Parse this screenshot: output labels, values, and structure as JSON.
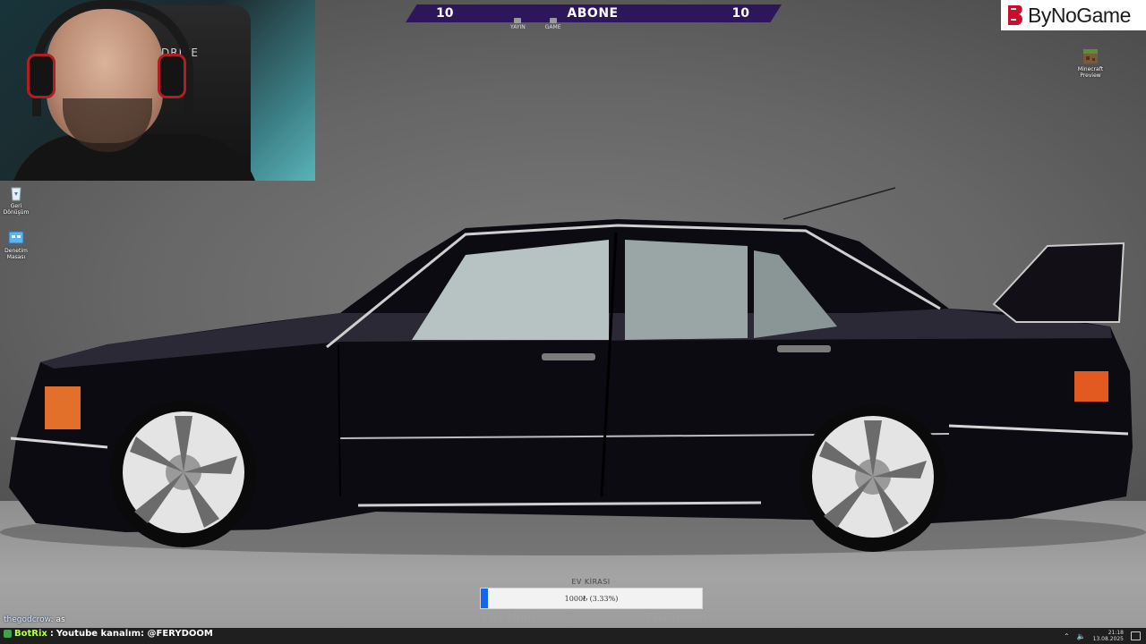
{
  "goal_banner": {
    "left_count": "10",
    "title": "ABONE",
    "right_count": "10",
    "sub_icons": [
      {
        "label": "YAYIN",
        "icon": "stream-icon"
      },
      {
        "label": "GAME",
        "icon": "game-icon"
      }
    ]
  },
  "logo": {
    "text": "ByNoGame",
    "icon": "bynogame-logo-icon"
  },
  "webcam": {
    "chair_brand": "DRIVE"
  },
  "desktop_icons": [
    {
      "label": "Geri Dönüşüm",
      "icon": "recycle-bin-icon"
    },
    {
      "label": "Denetim Masası",
      "icon": "control-panel-icon"
    },
    {
      "label": "Minecraft Preview",
      "icon": "minecraft-icon"
    }
  ],
  "donation_goal": {
    "title": "EV KİRASI",
    "progress_text": "1000₺ (3.33%)",
    "progress_fraction": 0.0333,
    "min_label": "TRY1000",
    "max_label": "TRY30000",
    "fill_color": "#1467e8"
  },
  "chat": [
    {
      "user": "thegodcrow",
      "separator": ":",
      "message": "as"
    },
    {
      "user": "BotRix",
      "separator": ":",
      "message": "Youtube kanalım: @FERYDOOM"
    }
  ],
  "taskbar": {
    "time": "21:18",
    "date": "13.08.2025",
    "tray_icons": [
      "chevron-up-icon",
      "volume-icon",
      "notification-icon"
    ]
  }
}
